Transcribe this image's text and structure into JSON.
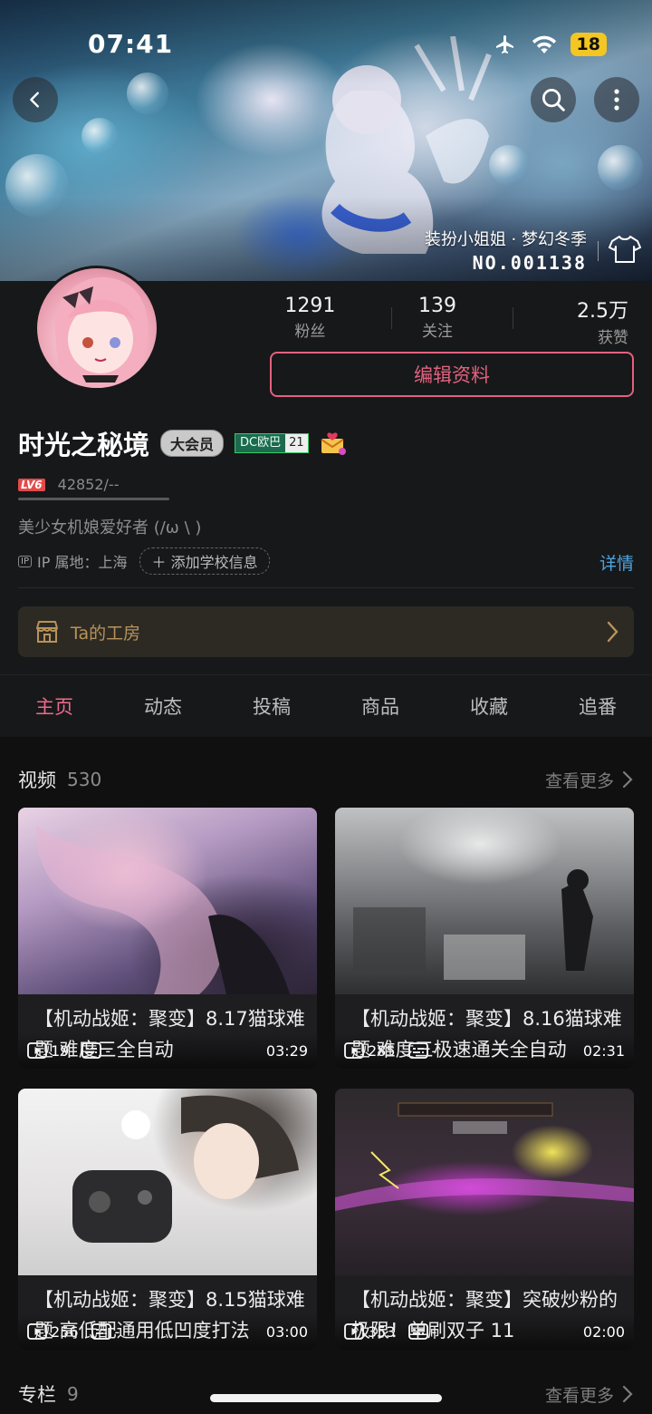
{
  "status_bar": {
    "time": "07:41",
    "battery": "18",
    "icons": [
      "airplane-icon",
      "wifi-icon"
    ]
  },
  "header": {
    "back_icon": "chevron-left-icon",
    "search_icon": "search-icon",
    "more_icon": "more-vertical-icon"
  },
  "banner": {
    "caption": "装扮小姐姐 · 梦幻冬季",
    "serial": "NO.001138",
    "shirt_icon": "shirt-icon"
  },
  "profile": {
    "stats": [
      {
        "value": "1291",
        "label": "粉丝"
      },
      {
        "value": "139",
        "label": "关注"
      },
      {
        "value": "2.5万",
        "label": "获赞"
      }
    ],
    "edit_label": "编辑资料",
    "username": "时光之秘境",
    "vip_label": "大会员",
    "dc_label": "DC欧巴",
    "dc_level": "21",
    "level": "LV6",
    "exp": "42852/--",
    "bio": "美少女机娘爱好者 (/ω \\ )",
    "ip_tag": "IP",
    "ip_label": "IP 属地：上海",
    "school_label": "添加学校信息",
    "detail_label": "详情"
  },
  "workshop": {
    "label": "Ta的工房"
  },
  "tabs": [
    {
      "label": "主页",
      "active": true
    },
    {
      "label": "动态"
    },
    {
      "label": "投稿"
    },
    {
      "label": "商品"
    },
    {
      "label": "收藏"
    },
    {
      "label": "追番"
    }
  ],
  "videos": {
    "title": "视频",
    "count": "530",
    "more_label": "查看更多",
    "items": [
      {
        "plays": "19",
        "danmaku": "-",
        "duration": "03:29",
        "title": "【机动战姬：聚变】8.17猫球难题 难度三全自动"
      },
      {
        "plays": "285",
        "danmaku": "-",
        "duration": "02:31",
        "title": "【机动战姬：聚变】8.16猫球难题 难度三极速通关全自动"
      },
      {
        "plays": "256",
        "danmaku": "-",
        "duration": "03:00",
        "title": "【机动战姬：聚变】8.15猫球难题 高低配通用低凹度打法"
      },
      {
        "plays": "353",
        "danmaku": "-",
        "duration": "02:00",
        "title": "【机动战姬：聚变】突破炒粉的极限！单刷双子 11"
      }
    ]
  },
  "columns": {
    "title": "专栏",
    "count": "9",
    "more_label": "查看更多"
  },
  "colors": {
    "accent": "#f06a8c",
    "link": "#4ea4de",
    "workshop": "#b8935a",
    "background": "#17181a"
  }
}
